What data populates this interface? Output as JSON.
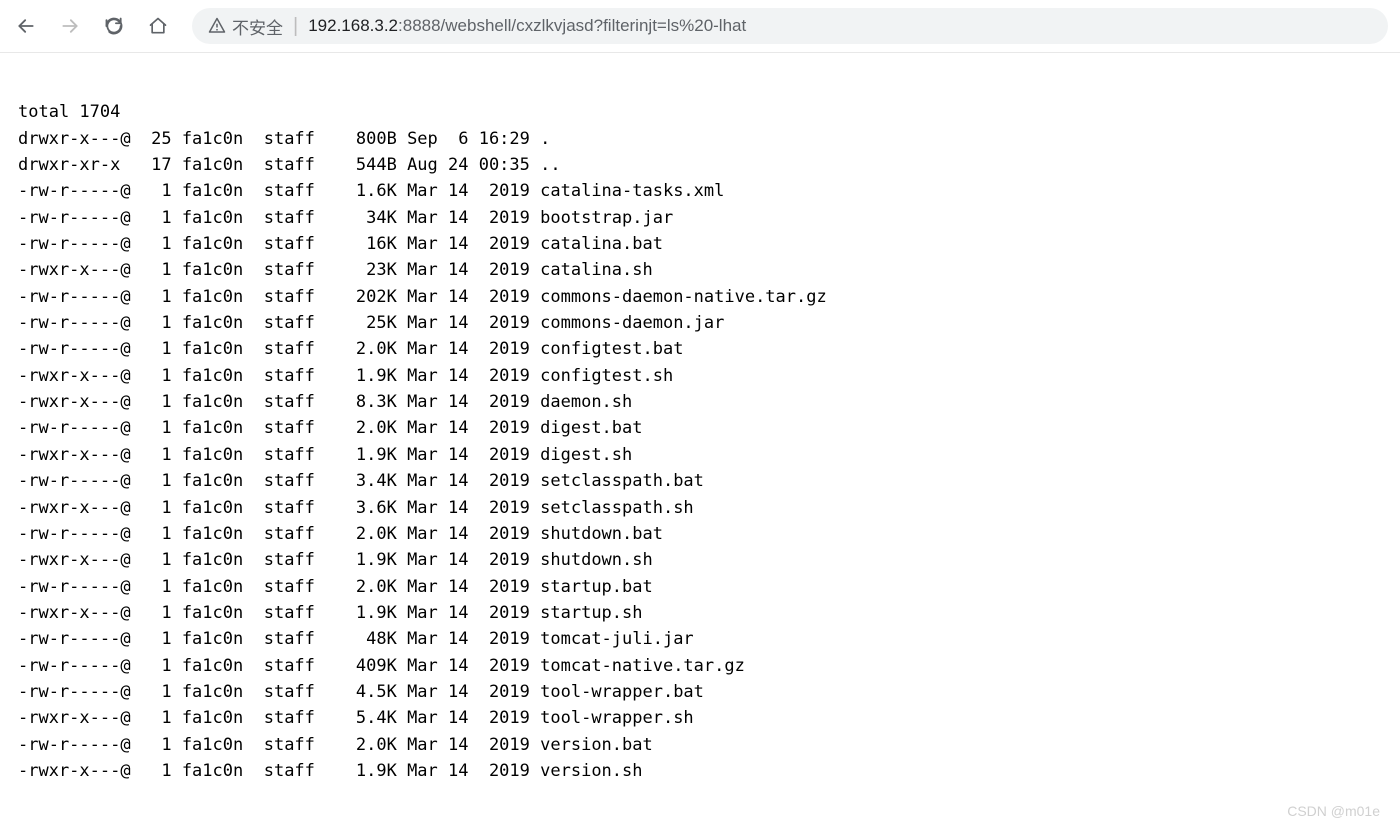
{
  "address_bar": {
    "insecure_label": "不安全",
    "url_host": "192.168.3.2",
    "url_port_path": ":8888/webshell/cxzlkvjasd?filterinjt=ls%20-lhat"
  },
  "listing": {
    "total_line": "total 1704",
    "rows": [
      {
        "perm": "drwxr-x---@",
        "links": "25",
        "user": "fa1c0n",
        "group": "staff",
        "size": "800B",
        "date": "Sep  6 16:29",
        "name": "."
      },
      {
        "perm": "drwxr-xr-x ",
        "links": "17",
        "user": "fa1c0n",
        "group": "staff",
        "size": "544B",
        "date": "Aug 24 00:35",
        "name": ".."
      },
      {
        "perm": "-rw-r-----@",
        "links": "1",
        "user": "fa1c0n",
        "group": "staff",
        "size": "1.6K",
        "date": "Mar 14  2019",
        "name": "catalina-tasks.xml"
      },
      {
        "perm": "-rw-r-----@",
        "links": "1",
        "user": "fa1c0n",
        "group": "staff",
        "size": "34K",
        "date": "Mar 14  2019",
        "name": "bootstrap.jar"
      },
      {
        "perm": "-rw-r-----@",
        "links": "1",
        "user": "fa1c0n",
        "group": "staff",
        "size": "16K",
        "date": "Mar 14  2019",
        "name": "catalina.bat"
      },
      {
        "perm": "-rwxr-x---@",
        "links": "1",
        "user": "fa1c0n",
        "group": "staff",
        "size": "23K",
        "date": "Mar 14  2019",
        "name": "catalina.sh"
      },
      {
        "perm": "-rw-r-----@",
        "links": "1",
        "user": "fa1c0n",
        "group": "staff",
        "size": "202K",
        "date": "Mar 14  2019",
        "name": "commons-daemon-native.tar.gz"
      },
      {
        "perm": "-rw-r-----@",
        "links": "1",
        "user": "fa1c0n",
        "group": "staff",
        "size": "25K",
        "date": "Mar 14  2019",
        "name": "commons-daemon.jar"
      },
      {
        "perm": "-rw-r-----@",
        "links": "1",
        "user": "fa1c0n",
        "group": "staff",
        "size": "2.0K",
        "date": "Mar 14  2019",
        "name": "configtest.bat"
      },
      {
        "perm": "-rwxr-x---@",
        "links": "1",
        "user": "fa1c0n",
        "group": "staff",
        "size": "1.9K",
        "date": "Mar 14  2019",
        "name": "configtest.sh"
      },
      {
        "perm": "-rwxr-x---@",
        "links": "1",
        "user": "fa1c0n",
        "group": "staff",
        "size": "8.3K",
        "date": "Mar 14  2019",
        "name": "daemon.sh"
      },
      {
        "perm": "-rw-r-----@",
        "links": "1",
        "user": "fa1c0n",
        "group": "staff",
        "size": "2.0K",
        "date": "Mar 14  2019",
        "name": "digest.bat"
      },
      {
        "perm": "-rwxr-x---@",
        "links": "1",
        "user": "fa1c0n",
        "group": "staff",
        "size": "1.9K",
        "date": "Mar 14  2019",
        "name": "digest.sh"
      },
      {
        "perm": "-rw-r-----@",
        "links": "1",
        "user": "fa1c0n",
        "group": "staff",
        "size": "3.4K",
        "date": "Mar 14  2019",
        "name": "setclasspath.bat"
      },
      {
        "perm": "-rwxr-x---@",
        "links": "1",
        "user": "fa1c0n",
        "group": "staff",
        "size": "3.6K",
        "date": "Mar 14  2019",
        "name": "setclasspath.sh"
      },
      {
        "perm": "-rw-r-----@",
        "links": "1",
        "user": "fa1c0n",
        "group": "staff",
        "size": "2.0K",
        "date": "Mar 14  2019",
        "name": "shutdown.bat"
      },
      {
        "perm": "-rwxr-x---@",
        "links": "1",
        "user": "fa1c0n",
        "group": "staff",
        "size": "1.9K",
        "date": "Mar 14  2019",
        "name": "shutdown.sh"
      },
      {
        "perm": "-rw-r-----@",
        "links": "1",
        "user": "fa1c0n",
        "group": "staff",
        "size": "2.0K",
        "date": "Mar 14  2019",
        "name": "startup.bat"
      },
      {
        "perm": "-rwxr-x---@",
        "links": "1",
        "user": "fa1c0n",
        "group": "staff",
        "size": "1.9K",
        "date": "Mar 14  2019",
        "name": "startup.sh"
      },
      {
        "perm": "-rw-r-----@",
        "links": "1",
        "user": "fa1c0n",
        "group": "staff",
        "size": "48K",
        "date": "Mar 14  2019",
        "name": "tomcat-juli.jar"
      },
      {
        "perm": "-rw-r-----@",
        "links": "1",
        "user": "fa1c0n",
        "group": "staff",
        "size": "409K",
        "date": "Mar 14  2019",
        "name": "tomcat-native.tar.gz"
      },
      {
        "perm": "-rw-r-----@",
        "links": "1",
        "user": "fa1c0n",
        "group": "staff",
        "size": "4.5K",
        "date": "Mar 14  2019",
        "name": "tool-wrapper.bat"
      },
      {
        "perm": "-rwxr-x---@",
        "links": "1",
        "user": "fa1c0n",
        "group": "staff",
        "size": "5.4K",
        "date": "Mar 14  2019",
        "name": "tool-wrapper.sh"
      },
      {
        "perm": "-rw-r-----@",
        "links": "1",
        "user": "fa1c0n",
        "group": "staff",
        "size": "2.0K",
        "date": "Mar 14  2019",
        "name": "version.bat"
      },
      {
        "perm": "-rwxr-x---@",
        "links": "1",
        "user": "fa1c0n",
        "group": "staff",
        "size": "1.9K",
        "date": "Mar 14  2019",
        "name": "version.sh"
      }
    ]
  },
  "watermark": "CSDN @m01e"
}
